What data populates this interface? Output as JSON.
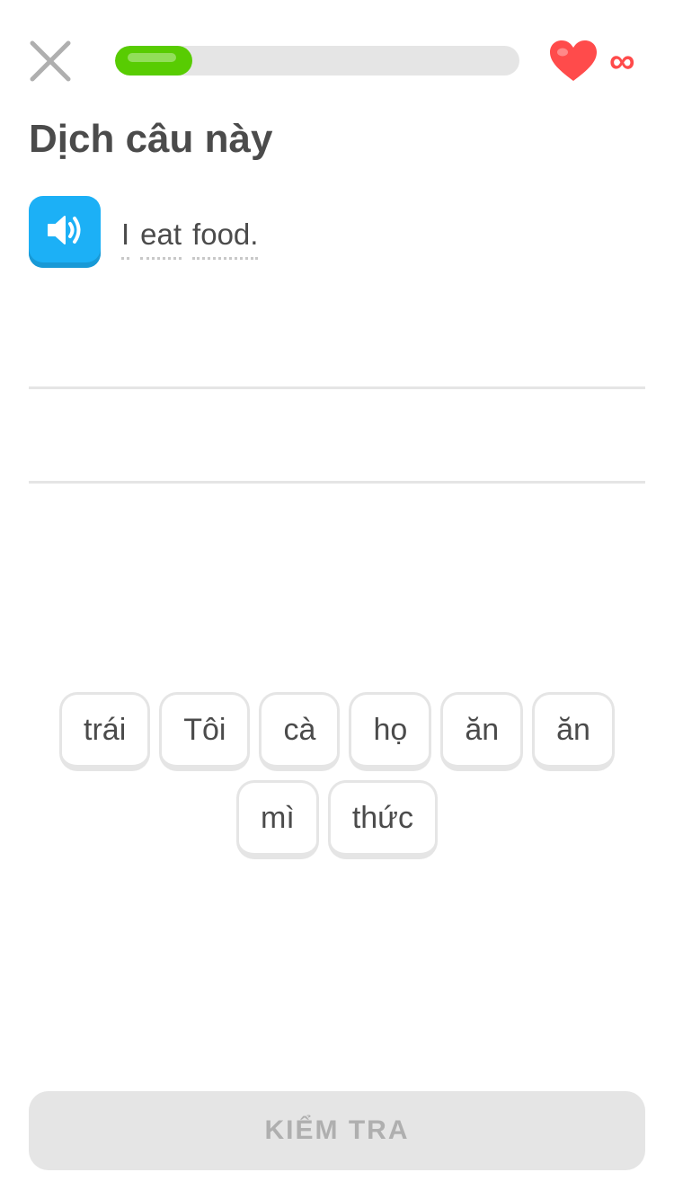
{
  "header": {
    "close_icon": "close-icon",
    "progress_fraction": 0.19,
    "hearts_label": "∞",
    "colors": {
      "progress": "#58cc02",
      "track": "#e5e5e5",
      "heart": "#ff4b4b"
    }
  },
  "title": "Dịch câu này",
  "prompt": {
    "speaker_icon": "speaker-icon",
    "words": [
      "I",
      "eat",
      "food."
    ]
  },
  "word_bank": {
    "tiles": [
      "trái",
      "Tôi",
      "cà",
      "họ",
      "ăn",
      "ăn",
      "mì",
      "thức"
    ]
  },
  "footer": {
    "check_label": "KIỂM TRA"
  },
  "colors": {
    "accent_blue": "#1cb0f6",
    "text": "#4b4b4b",
    "disabled_text": "#afafaf",
    "disabled_bg": "#e5e5e5"
  }
}
